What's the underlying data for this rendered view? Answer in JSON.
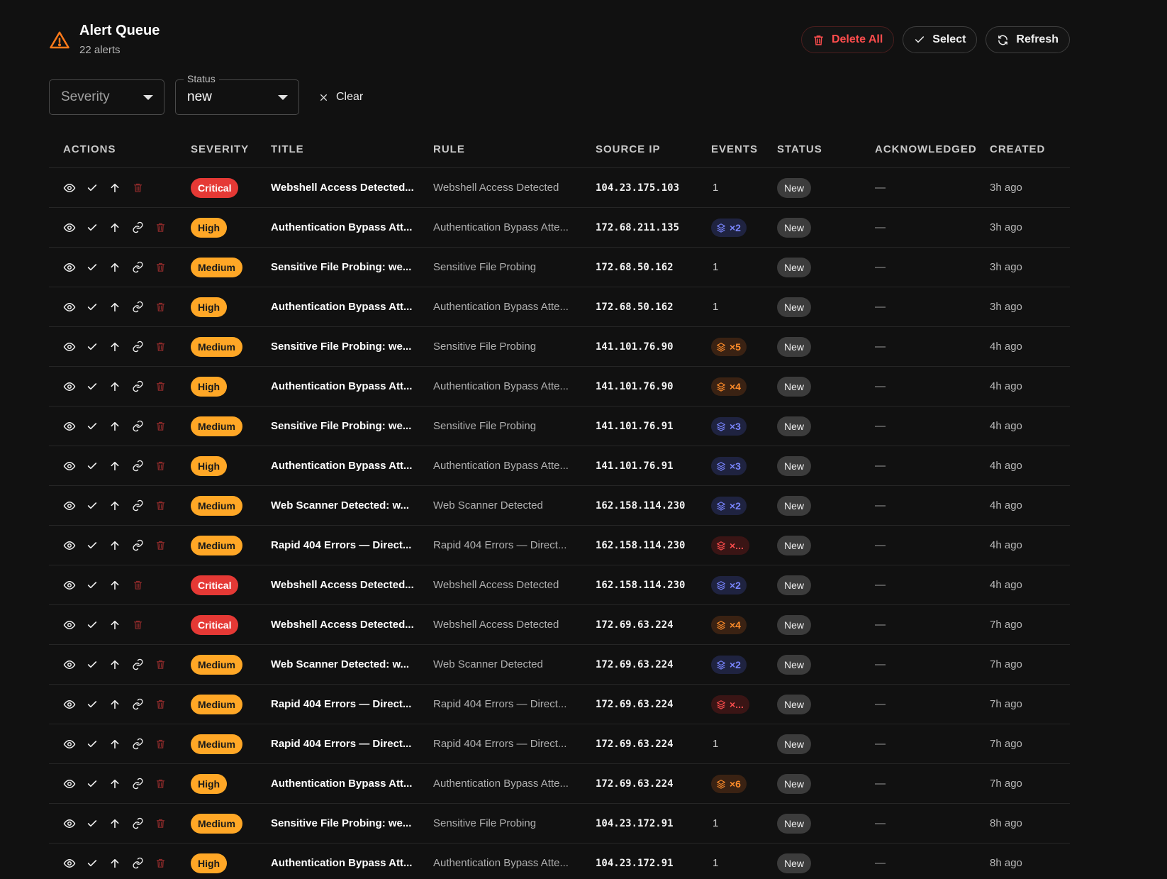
{
  "header": {
    "title": "Alert Queue",
    "subtitle": "22 alerts",
    "delete_all_label": "Delete All",
    "select_label": "Select",
    "refresh_label": "Refresh"
  },
  "filters": {
    "severity_placeholder": "Severity",
    "status_legend": "Status",
    "status_value": "new",
    "clear_label": "Clear"
  },
  "columns": {
    "actions": "ACTIONS",
    "severity": "SEVERITY",
    "title": "TITLE",
    "rule": "RULE",
    "source_ip": "SOURCE IP",
    "events": "EVENTS",
    "status": "STATUS",
    "acknowledged": "ACKNOWLEDGED",
    "created": "CREATED"
  },
  "colors": {
    "critical": "#e53935",
    "high_medium": "#ffa726",
    "events_blue": "#7a86ff",
    "events_orange": "#ff8c2a",
    "events_red": "#ff4d4d",
    "delete_red": "#ff4d4d",
    "warning_orange": "#ff7a1a"
  },
  "rows": [
    {
      "link": false,
      "severity": "Critical",
      "title": "Webshell Access Detected...",
      "rule": "Webshell Access Detected",
      "ip": "104.23.175.103",
      "events": "1",
      "events_style": "plain",
      "status": "New",
      "ack": "—",
      "created": "3h ago"
    },
    {
      "link": true,
      "severity": "High",
      "title": "Authentication Bypass Att...",
      "rule": "Authentication Bypass Atte...",
      "ip": "172.68.211.135",
      "events": "×2",
      "events_style": "blue",
      "status": "New",
      "ack": "—",
      "created": "3h ago"
    },
    {
      "link": true,
      "severity": "Medium",
      "title": "Sensitive File Probing: we...",
      "rule": "Sensitive File Probing",
      "ip": "172.68.50.162",
      "events": "1",
      "events_style": "plain",
      "status": "New",
      "ack": "—",
      "created": "3h ago"
    },
    {
      "link": true,
      "severity": "High",
      "title": "Authentication Bypass Att...",
      "rule": "Authentication Bypass Atte...",
      "ip": "172.68.50.162",
      "events": "1",
      "events_style": "plain",
      "status": "New",
      "ack": "—",
      "created": "3h ago"
    },
    {
      "link": true,
      "severity": "Medium",
      "title": "Sensitive File Probing: we...",
      "rule": "Sensitive File Probing",
      "ip": "141.101.76.90",
      "events": "×5",
      "events_style": "orange",
      "status": "New",
      "ack": "—",
      "created": "4h ago"
    },
    {
      "link": true,
      "severity": "High",
      "title": "Authentication Bypass Att...",
      "rule": "Authentication Bypass Atte...",
      "ip": "141.101.76.90",
      "events": "×4",
      "events_style": "orange",
      "status": "New",
      "ack": "—",
      "created": "4h ago"
    },
    {
      "link": true,
      "severity": "Medium",
      "title": "Sensitive File Probing: we...",
      "rule": "Sensitive File Probing",
      "ip": "141.101.76.91",
      "events": "×3",
      "events_style": "blue",
      "status": "New",
      "ack": "—",
      "created": "4h ago"
    },
    {
      "link": true,
      "severity": "High",
      "title": "Authentication Bypass Att...",
      "rule": "Authentication Bypass Atte...",
      "ip": "141.101.76.91",
      "events": "×3",
      "events_style": "blue",
      "status": "New",
      "ack": "—",
      "created": "4h ago"
    },
    {
      "link": true,
      "severity": "Medium",
      "title": "Web Scanner Detected: w...",
      "rule": "Web Scanner Detected",
      "ip": "162.158.114.230",
      "events": "×2",
      "events_style": "blue",
      "status": "New",
      "ack": "—",
      "created": "4h ago"
    },
    {
      "link": true,
      "severity": "Medium",
      "title": "Rapid 404 Errors — Direct...",
      "rule": "Rapid 404 Errors — Direct...",
      "ip": "162.158.114.230",
      "events": "×...",
      "events_style": "red",
      "status": "New",
      "ack": "—",
      "created": "4h ago"
    },
    {
      "link": false,
      "severity": "Critical",
      "title": "Webshell Access Detected...",
      "rule": "Webshell Access Detected",
      "ip": "162.158.114.230",
      "events": "×2",
      "events_style": "blue",
      "status": "New",
      "ack": "—",
      "created": "4h ago"
    },
    {
      "link": false,
      "severity": "Critical",
      "title": "Webshell Access Detected...",
      "rule": "Webshell Access Detected",
      "ip": "172.69.63.224",
      "events": "×4",
      "events_style": "orange",
      "status": "New",
      "ack": "—",
      "created": "7h ago"
    },
    {
      "link": true,
      "severity": "Medium",
      "title": "Web Scanner Detected: w...",
      "rule": "Web Scanner Detected",
      "ip": "172.69.63.224",
      "events": "×2",
      "events_style": "blue",
      "status": "New",
      "ack": "—",
      "created": "7h ago"
    },
    {
      "link": true,
      "severity": "Medium",
      "title": "Rapid 404 Errors — Direct...",
      "rule": "Rapid 404 Errors — Direct...",
      "ip": "172.69.63.224",
      "events": "×...",
      "events_style": "red",
      "status": "New",
      "ack": "—",
      "created": "7h ago"
    },
    {
      "link": true,
      "severity": "Medium",
      "title": "Rapid 404 Errors — Direct...",
      "rule": "Rapid 404 Errors — Direct...",
      "ip": "172.69.63.224",
      "events": "1",
      "events_style": "plain",
      "status": "New",
      "ack": "—",
      "created": "7h ago"
    },
    {
      "link": true,
      "severity": "High",
      "title": "Authentication Bypass Att...",
      "rule": "Authentication Bypass Atte...",
      "ip": "172.69.63.224",
      "events": "×6",
      "events_style": "orange",
      "status": "New",
      "ack": "—",
      "created": "7h ago"
    },
    {
      "link": true,
      "severity": "Medium",
      "title": "Sensitive File Probing: we...",
      "rule": "Sensitive File Probing",
      "ip": "104.23.172.91",
      "events": "1",
      "events_style": "plain",
      "status": "New",
      "ack": "—",
      "created": "8h ago"
    },
    {
      "link": true,
      "severity": "High",
      "title": "Authentication Bypass Att...",
      "rule": "Authentication Bypass Atte...",
      "ip": "104.23.172.91",
      "events": "1",
      "events_style": "plain",
      "status": "New",
      "ack": "—",
      "created": "8h ago"
    }
  ]
}
